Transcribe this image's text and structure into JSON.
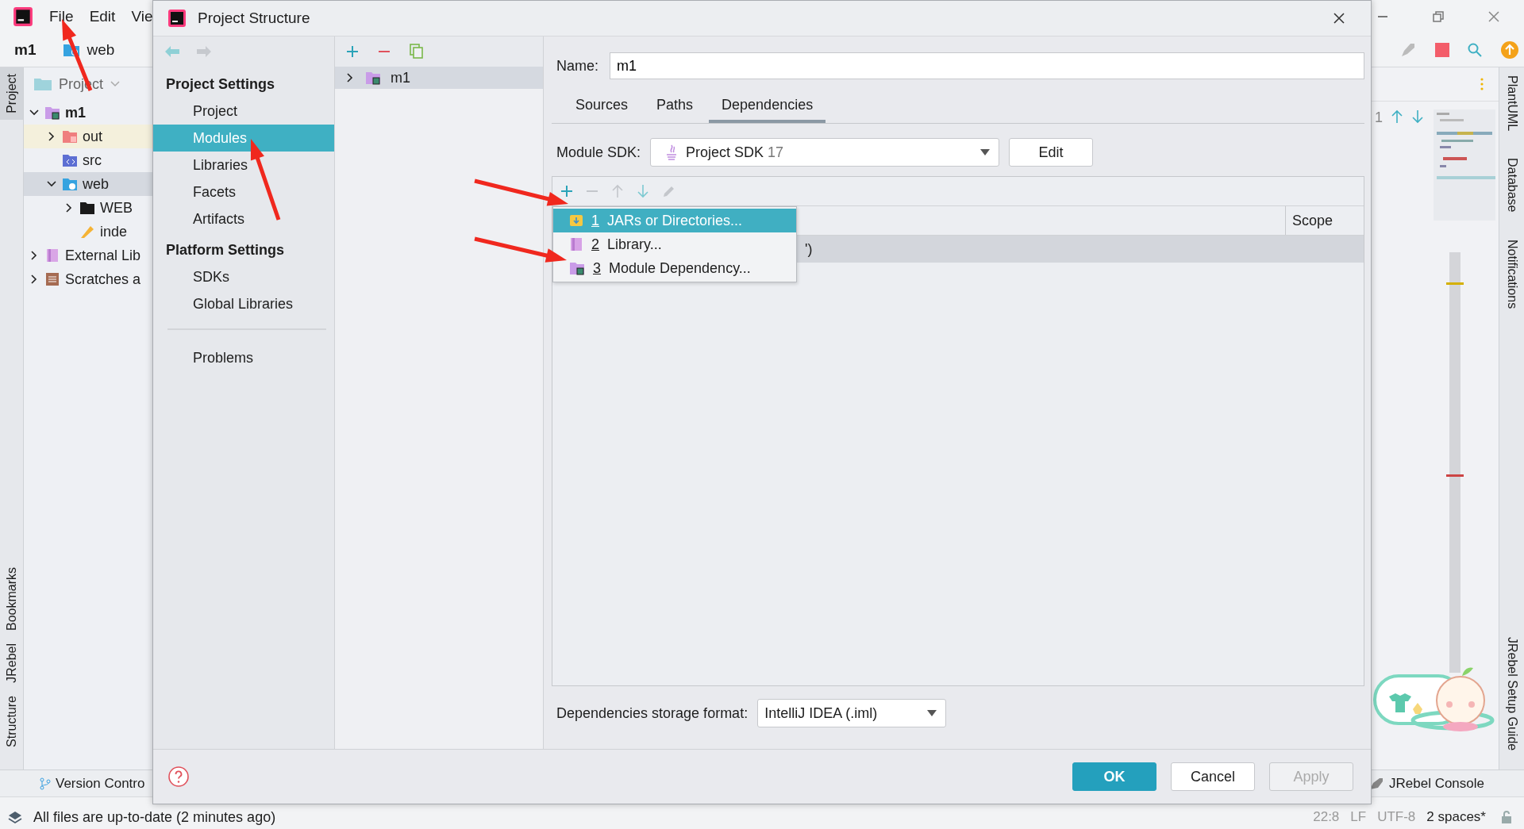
{
  "ide": {
    "menu": [
      "File",
      "Edit",
      "Vie"
    ],
    "breadcrumb": [
      {
        "label": "m1",
        "kind": "module"
      },
      {
        "label": "web",
        "kind": "web"
      }
    ],
    "left_tabs": [
      {
        "label": "Project",
        "kind": "project",
        "selected": true
      },
      {
        "label": "Bookmarks",
        "kind": "bookmarks",
        "selected": false
      },
      {
        "label": "JRebel",
        "kind": "jrebel",
        "selected": false
      },
      {
        "label": "Structure",
        "kind": "structure",
        "selected": false
      }
    ],
    "project_panel": {
      "title": "Project",
      "tree": [
        {
          "label": "m1",
          "kind": "module",
          "expanded": true,
          "selected": false,
          "children": [
            {
              "label": "out",
              "kind": "excluded",
              "expanded": false,
              "selected": false
            },
            {
              "label": "src",
              "kind": "source",
              "selected": false
            },
            {
              "label": "web",
              "kind": "web",
              "expanded": true,
              "selected": true,
              "children": [
                {
                  "label": "WEB",
                  "kind": "folder",
                  "expanded": false,
                  "selected": false
                },
                {
                  "label": "inde",
                  "kind": "jsp",
                  "selected": false
                }
              ]
            }
          ]
        },
        {
          "label": "External Lib",
          "kind": "libraries",
          "expanded": false,
          "selected": false
        },
        {
          "label": "Scratches a",
          "kind": "scratches",
          "expanded": false,
          "selected": false
        }
      ]
    },
    "editor": {
      "line_number": "1"
    },
    "right_tabs": [
      {
        "label": "PlantUML",
        "kind": "plantuml"
      },
      {
        "label": "Database",
        "kind": "database"
      },
      {
        "label": "Notifications",
        "kind": "bell"
      },
      {
        "label": "JRebel Setup Guide",
        "kind": "jrebel"
      }
    ],
    "bottom_tools": [
      {
        "label": "Version Contro",
        "kind": "vcs"
      },
      {
        "label": "JRebel Console",
        "kind": "jrebel"
      }
    ],
    "status_bar": {
      "message": "All files are up-to-date (2 minutes ago)",
      "position": "22:8",
      "line_separator": "LF",
      "encoding": "UTF-8",
      "indent": "2 spaces*"
    }
  },
  "dialog": {
    "title": "Project Structure",
    "nav": [
      {
        "heading": "Project Settings",
        "items": [
          {
            "label": "Project",
            "selected": false
          },
          {
            "label": "Modules",
            "selected": true
          },
          {
            "label": "Libraries",
            "selected": false
          },
          {
            "label": "Facets",
            "selected": false
          },
          {
            "label": "Artifacts",
            "selected": false
          }
        ]
      },
      {
        "heading": "Platform Settings",
        "items": [
          {
            "label": "SDKs",
            "selected": false
          },
          {
            "label": "Global Libraries",
            "selected": false
          }
        ]
      }
    ],
    "extra_items": [
      {
        "label": "Problems",
        "selected": false
      }
    ],
    "modules": [
      {
        "label": "m1",
        "expanded": false,
        "selected": true
      }
    ],
    "name_label": "Name:",
    "name_value": "m1",
    "tabs": [
      {
        "label": "Sources",
        "selected": false
      },
      {
        "label": "Paths",
        "selected": false
      },
      {
        "label": "Dependencies",
        "selected": true
      }
    ],
    "sdk_label": "Module SDK:",
    "sdk_value": "Project SDK",
    "sdk_version": "17",
    "edit_button": "Edit",
    "table": {
      "columns": [
        "Scope"
      ],
      "rows": [
        {
          "cell": "')",
          "selected": true
        }
      ]
    },
    "popup": [
      {
        "number": "1",
        "label": "JARs or Directories...",
        "kind": "jar",
        "selected": true
      },
      {
        "number": "2",
        "label": "Library...",
        "kind": "library",
        "selected": false
      },
      {
        "number": "3",
        "label": "Module Dependency...",
        "kind": "module",
        "selected": false
      }
    ],
    "storage_label": "Dependencies storage format:",
    "storage_value": "IntelliJ IDEA (.iml)",
    "buttons": [
      {
        "label": "OK",
        "kind": "primary",
        "disabled": false
      },
      {
        "label": "Cancel",
        "kind": "normal",
        "disabled": false
      },
      {
        "label": "Apply",
        "kind": "normal",
        "disabled": true
      }
    ]
  }
}
